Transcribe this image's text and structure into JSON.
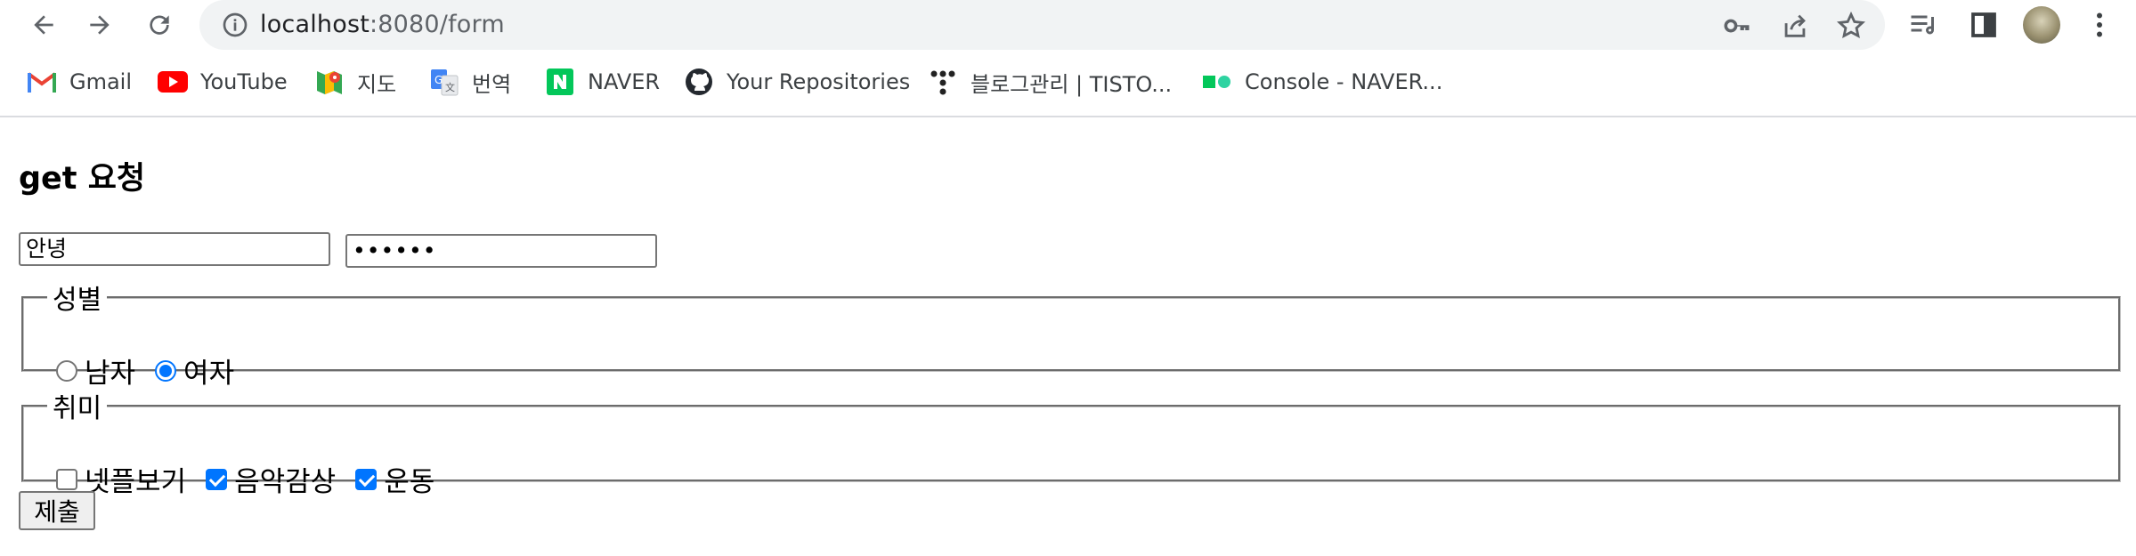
{
  "browser": {
    "url_host": "localhost",
    "url_rest": ":8080/form",
    "accent": "#1a73e8"
  },
  "bookmarks": [
    {
      "label": "Gmail",
      "icon": "gmail-icon"
    },
    {
      "label": "YouTube",
      "icon": "youtube-icon"
    },
    {
      "label": "지도",
      "icon": "maps-icon"
    },
    {
      "label": "번역",
      "icon": "translate-icon"
    },
    {
      "label": "NAVER",
      "icon": "naver-icon"
    },
    {
      "label": "Your Repositories",
      "icon": "github-icon"
    },
    {
      "label": "블로그관리 | TISTO...",
      "icon": "tistory-icon"
    },
    {
      "label": "Console - NAVER...",
      "icon": "naver-cloud-icon"
    }
  ],
  "form": {
    "title": "get 요청",
    "name_value": "안녕",
    "password_value": "••••••",
    "gender": {
      "legend": "성별",
      "options": [
        {
          "label": "남자",
          "checked": false
        },
        {
          "label": "여자",
          "checked": true
        }
      ]
    },
    "hobby": {
      "legend": "취미",
      "options": [
        {
          "label": "넷플보기",
          "checked": false
        },
        {
          "label": "음악감상",
          "checked": true
        },
        {
          "label": "운동",
          "checked": true
        }
      ]
    },
    "submit_label": "제출"
  }
}
